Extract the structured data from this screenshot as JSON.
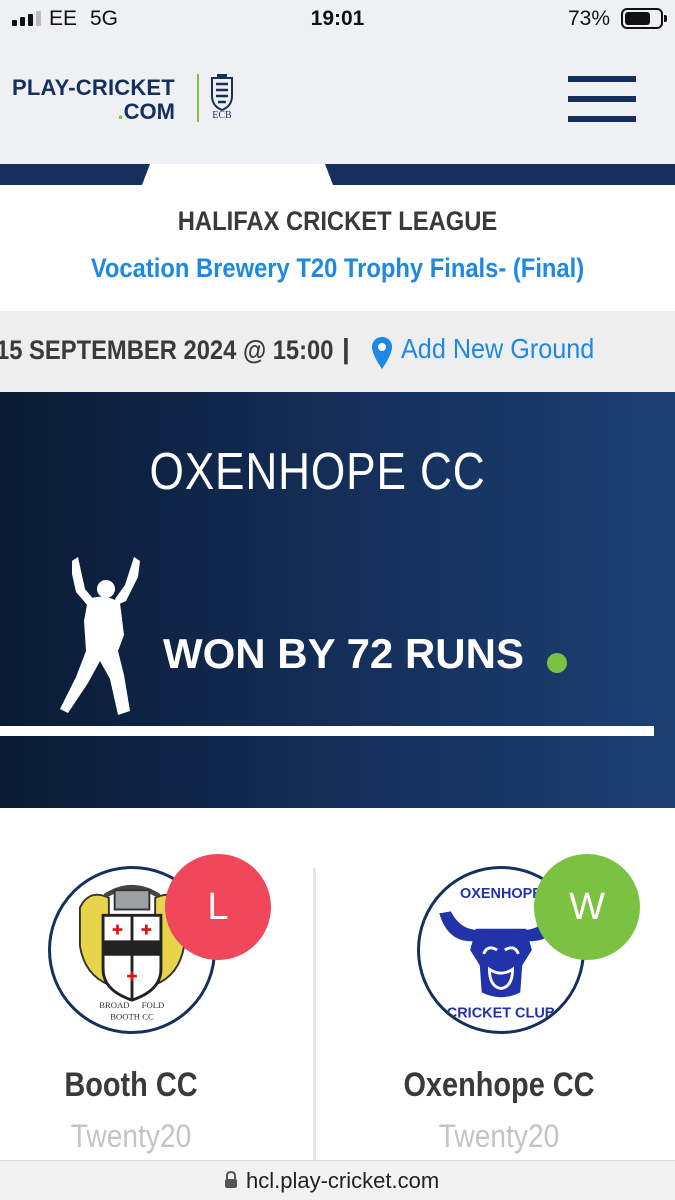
{
  "status_bar": {
    "carrier": "EE",
    "network": "5G",
    "time": "19:01",
    "battery_percent": "73%",
    "battery_level": 0.73
  },
  "header": {
    "logo_line1": "PLAY-CRICKET",
    "logo_line2_dot": ".",
    "logo_line2": "COM",
    "ecb_text": "ECB",
    "menu_icon": "hamburger-menu-icon"
  },
  "match": {
    "league": "HALIFAX CRICKET LEAGUE",
    "competition": "Vocation Brewery T20 Trophy Finals- (Final)",
    "date_time": "15 SEPTEMBER 2024 @ 15:00",
    "separator": "|",
    "ground_link": "Add New Ground"
  },
  "result": {
    "winner": "OXENHOPE CC",
    "text": "WON BY 72 RUNS",
    "icon": "bowler-silhouette-icon"
  },
  "teams": [
    {
      "name": "Booth CC",
      "format": "Twenty20",
      "badge": "L",
      "badge_color": "#f0485a",
      "crest_text_top": "BROAD",
      "crest_text_right": "FOLD",
      "crest_text_bottom": "BOOTH CC"
    },
    {
      "name": "Oxenhope CC",
      "format": "Twenty20",
      "badge": "W",
      "badge_color": "#7cc242",
      "crest_text_top": "OXENHOPE",
      "crest_text_bottom": "CRICKET CLUB"
    }
  ],
  "colors": {
    "navy": "#15305c",
    "link_blue": "#1e88e5",
    "accent_green": "#7cc242",
    "loss_red": "#f0485a"
  },
  "browser": {
    "url": "hcl.play-cricket.com"
  }
}
